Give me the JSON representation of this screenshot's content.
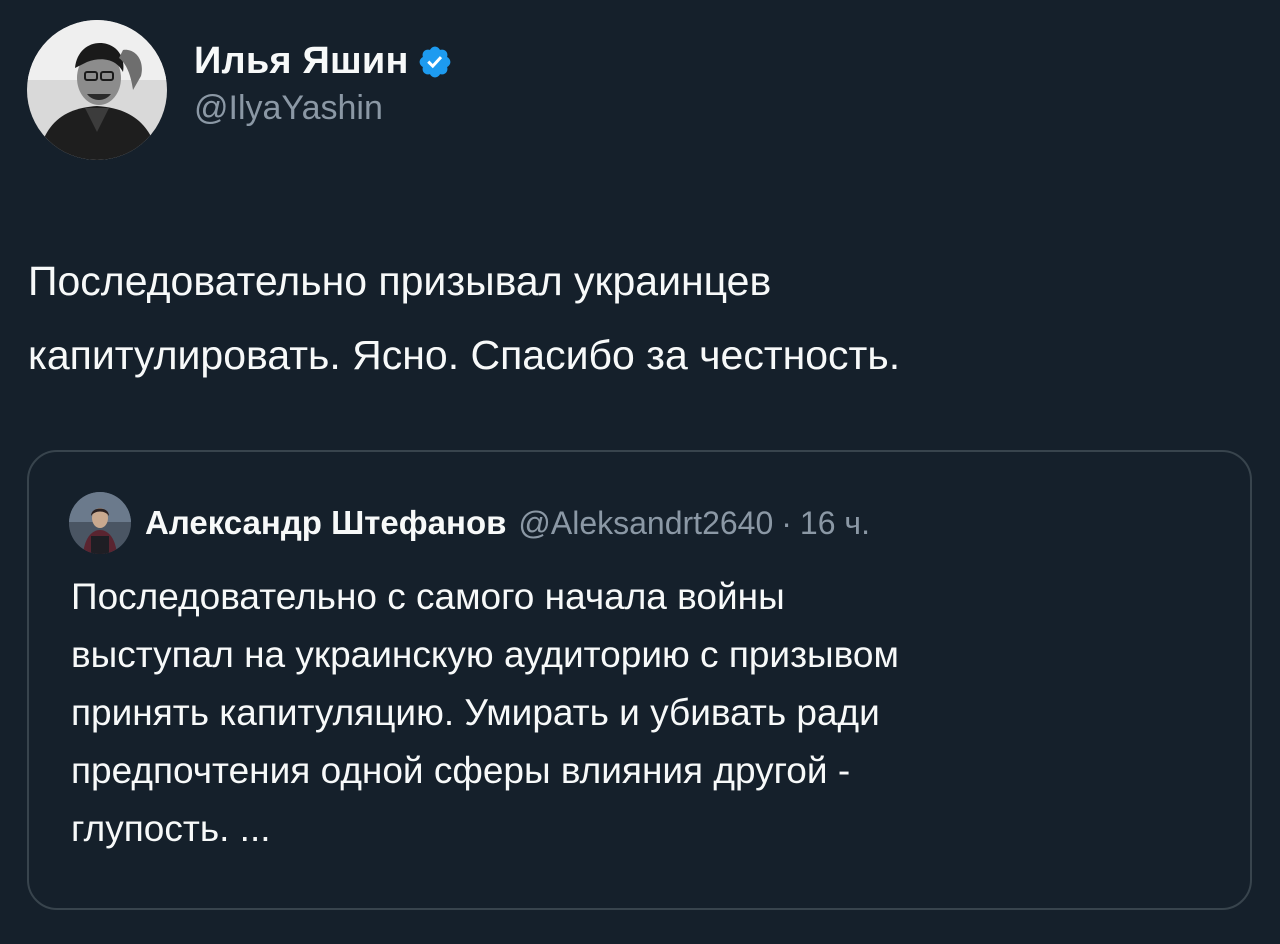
{
  "author": {
    "display_name": "Илья Яшин",
    "handle": "@IlyaYashin",
    "verified_icon": "verified-badge-icon",
    "avatar_icon": "profile-photo"
  },
  "tweet": {
    "text": "Последовательно призывал украинцев\nкапитулировать. Ясно. Спасибо за честность."
  },
  "quoted_tweet": {
    "display_name": "Александр Штефанов",
    "handle": "@Aleksandrt2640",
    "separator": "·",
    "time": "16 ч.",
    "text": "Последовательно с самого начала войны\nвыступал на украинскую аудиторию с призывом\nпринять капитуляцию. Умирать и убивать ради\nпредпочтения одной сферы влияния другой -\nглупость. ..."
  },
  "colors": {
    "background": "#15202b",
    "text_primary": "#f7f9f9",
    "text_secondary": "#8b98a5",
    "border": "#38444d",
    "verified": "#1d9bf0"
  }
}
